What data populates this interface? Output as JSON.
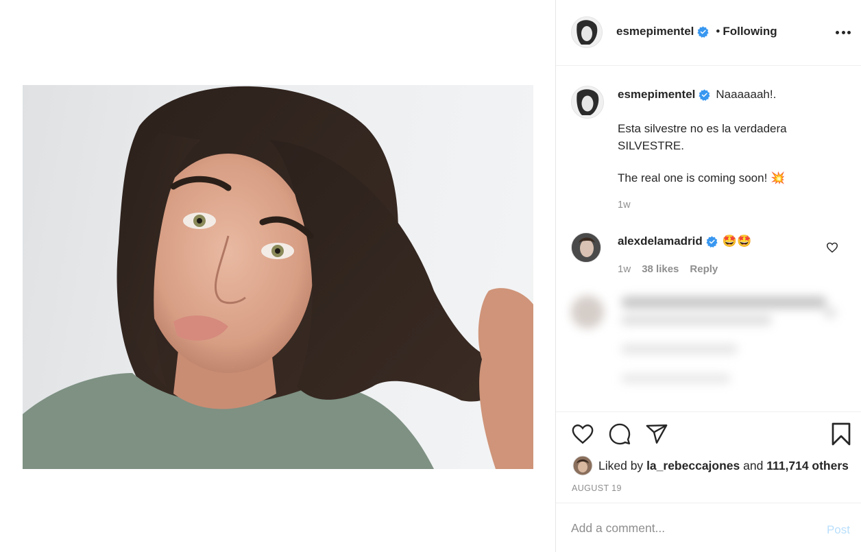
{
  "post": {
    "author": "esmepimentel",
    "follow_separator": "•",
    "follow_status": "Following",
    "caption": {
      "author": "esmepimentel",
      "first_line": "Naaaaaah!.",
      "paragraph1_line1": "Esta silvestre no es la verdadera",
      "paragraph1_line2": "SILVESTRE.",
      "paragraph2": "The real one is coming soon!",
      "emoji": "💥",
      "time": "1w"
    },
    "comments": [
      {
        "author": "alexdelamadrid",
        "text": "🤩🤩",
        "time": "1w",
        "likes": "38 likes",
        "reply": "Reply"
      }
    ],
    "liked_by": {
      "prefix": "Liked by",
      "user": "la_rebeccajones",
      "connector": "and",
      "others": "111,714 others"
    },
    "date": "AUGUST 19",
    "add_comment": {
      "placeholder": "Add a comment...",
      "post_label": "Post"
    }
  },
  "colors": {
    "verified_badge": "#3897f0",
    "muted_text": "#8e8e8e",
    "post_button_disabled": "#b9dffc",
    "primary_text": "#262626"
  },
  "icons": [
    "verified-badge-icon",
    "more-options-icon",
    "heart-icon",
    "comment-icon",
    "share-icon",
    "bookmark-icon",
    "small-heart-icon"
  ]
}
